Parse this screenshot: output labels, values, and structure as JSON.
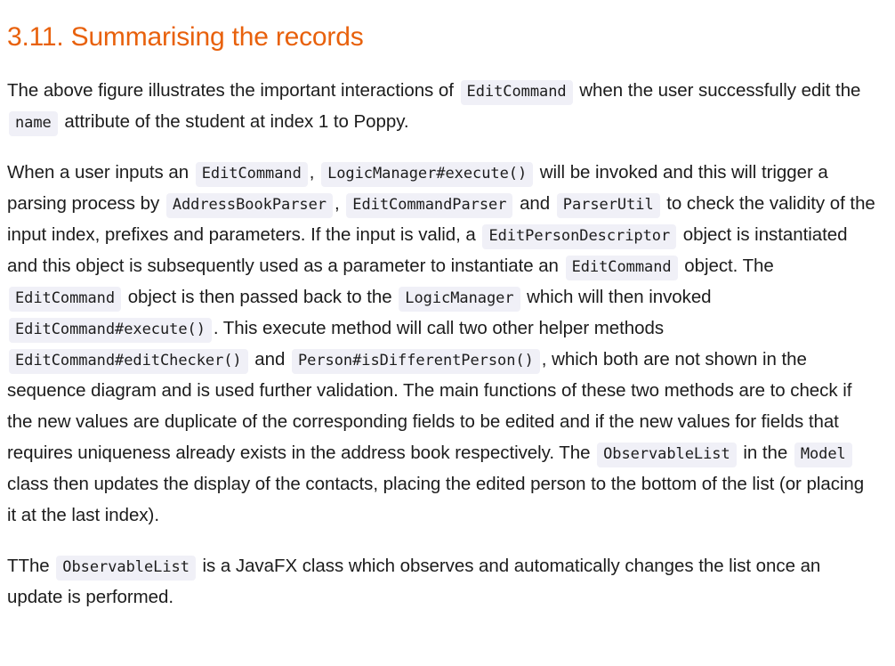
{
  "document": {
    "heading": "3.11. Summarising the records",
    "accent_color": "#e8610c",
    "text_color": "#1c1c1c",
    "code_background": "#f0f0f7",
    "background": "#ffffff"
  },
  "paragraphs": [
    {
      "id": "p1",
      "segments": [
        {
          "type": "text",
          "value": "The above figure illustrates the important interactions of "
        },
        {
          "type": "code",
          "value": "EditCommand"
        },
        {
          "type": "text",
          "value": " when the user successfully edit the "
        },
        {
          "type": "code",
          "value": "name"
        },
        {
          "type": "text",
          "value": " attribute of the student at index 1 to Poppy."
        }
      ]
    },
    {
      "id": "p2",
      "segments": [
        {
          "type": "text",
          "value": "When a user inputs an "
        },
        {
          "type": "code",
          "value": "EditCommand"
        },
        {
          "type": "text",
          "value": ", "
        },
        {
          "type": "code",
          "value": "LogicManager#execute()"
        },
        {
          "type": "text",
          "value": " will be invoked and this will trigger a parsing process by "
        },
        {
          "type": "code",
          "value": "AddressBookParser"
        },
        {
          "type": "text",
          "value": ", "
        },
        {
          "type": "code",
          "value": "EditCommandParser"
        },
        {
          "type": "text",
          "value": " and "
        },
        {
          "type": "code",
          "value": "ParserUtil"
        },
        {
          "type": "text",
          "value": " to check the validity of the input index, prefixes and parameters. If the input is valid, a "
        },
        {
          "type": "code",
          "value": "EditPersonDescriptor"
        },
        {
          "type": "text",
          "value": " object is instantiated and this object is subsequently used as a parameter to instantiate an "
        },
        {
          "type": "code",
          "value": "EditCommand"
        },
        {
          "type": "text",
          "value": " object. The "
        },
        {
          "type": "code",
          "value": "EditCommand"
        },
        {
          "type": "text",
          "value": " object is then passed back to the "
        },
        {
          "type": "code",
          "value": "LogicManager"
        },
        {
          "type": "text",
          "value": " which will then invoked "
        },
        {
          "type": "code",
          "value": "EditCommand#execute()"
        },
        {
          "type": "text",
          "value": ". This execute method will call two other helper methods "
        },
        {
          "type": "code",
          "value": "EditCommand#editChecker()"
        },
        {
          "type": "text",
          "value": " and "
        },
        {
          "type": "code",
          "value": "Person#isDifferentPerson()"
        },
        {
          "type": "text",
          "value": ", which both are not shown in the sequence diagram and is used further validation. The main functions of these two methods are to check if the new values are duplicate of the corresponding fields to be edited and if the new values for fields that requires uniqueness already exists in the address book respectively. The "
        },
        {
          "type": "code",
          "value": "ObservableList"
        },
        {
          "type": "text",
          "value": " in the "
        },
        {
          "type": "code",
          "value": "Model"
        },
        {
          "type": "text",
          "value": " class then updates the display of the contacts, placing the edited person to the bottom of the list (or placing it at the last index)."
        }
      ]
    },
    {
      "id": "p3",
      "segments": [
        {
          "type": "text",
          "value": "TThe "
        },
        {
          "type": "code",
          "value": "ObservableList"
        },
        {
          "type": "text",
          "value": " is a JavaFX class which observes and automatically changes the list once an update is performed."
        }
      ]
    }
  ]
}
